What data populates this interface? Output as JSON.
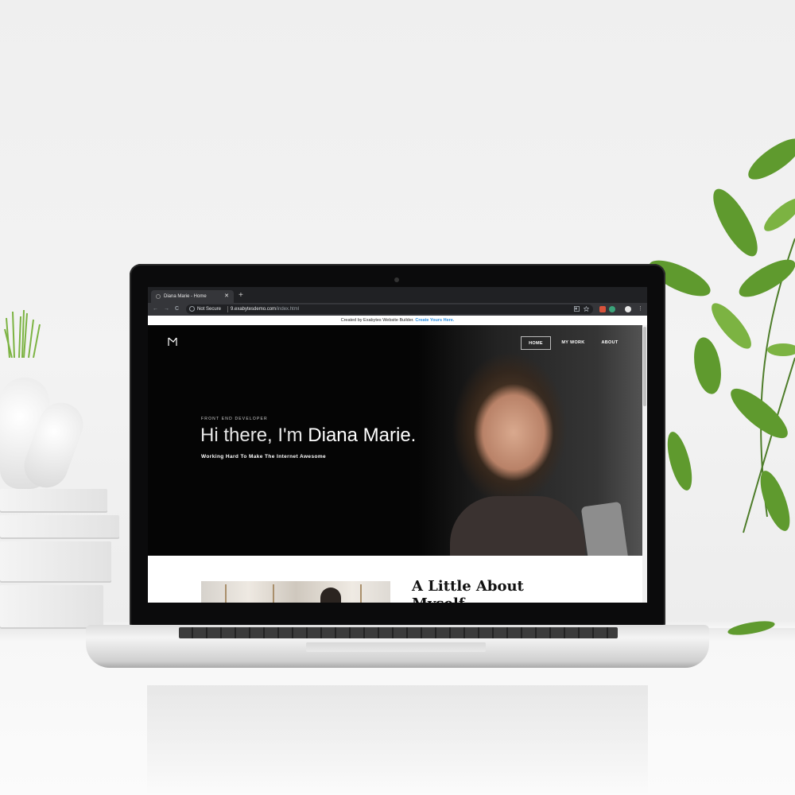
{
  "browser": {
    "tab_title": "Diana Marie - Home",
    "tab_close": "✕",
    "new_tab": "+",
    "security_label": "Not Secure",
    "url_host": "9.exabytesdemo.com",
    "url_path": "/index.html",
    "nav_back": "←",
    "nav_forward": "→",
    "nav_reload": "C",
    "menu_dots": "⋮"
  },
  "banner": {
    "text": "Created by Exabytes Website Builder.",
    "link": "Create Yours Here."
  },
  "site": {
    "nav": [
      "HOME",
      "MY WORK",
      "ABOUT"
    ],
    "active_nav": "HOME",
    "eyebrow": "FRONT END DEVELOPER",
    "headline_prefix": "Hi there, I'm ",
    "headline_name": "Diana Marie.",
    "tagline": "Working Hard To Make The Internet Awesome",
    "about_title_line1": "A Little About",
    "about_title_line2": "Myself"
  },
  "colors": {
    "hero_bg": "#050505",
    "link": "#2b8de0",
    "chrome_dark": "#202124"
  },
  "icons": [
    "logo-icon",
    "info-icon",
    "translate-icon",
    "star-icon",
    "extension-icon",
    "profile-icon"
  ]
}
